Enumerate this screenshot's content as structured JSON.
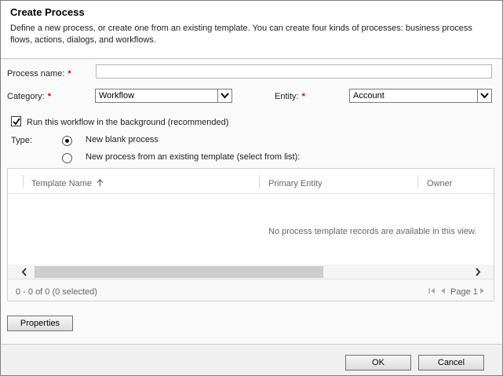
{
  "dialog": {
    "title": "Create Process",
    "description": "Define a new process, or create one from an existing template. You can create four kinds of processes: business process flows, actions, dialogs, and workflows."
  },
  "form": {
    "process_name_label": "Process name:",
    "process_name_value": "",
    "required_marker": "*",
    "category_label": "Category:",
    "category_value": "Workflow",
    "entity_label": "Entity:",
    "entity_value": "Account",
    "background_checkbox_label": "Run this workflow in the background (recommended)",
    "background_checked": true,
    "type_label": "Type:",
    "type_options": [
      {
        "label": "New blank process",
        "selected": true
      },
      {
        "label": "New process from an existing template (select from list):",
        "selected": false
      }
    ]
  },
  "grid": {
    "columns": [
      "Template Name",
      "Primary Entity",
      "Owner"
    ],
    "sort_icon": "arrow-up-icon",
    "empty_message": "No process template records are available in this view.",
    "record_count": "0 - 0 of 0 (0 selected)",
    "page_label": "Page 1"
  },
  "buttons": {
    "properties": "Properties",
    "ok": "OK",
    "cancel": "Cancel"
  }
}
